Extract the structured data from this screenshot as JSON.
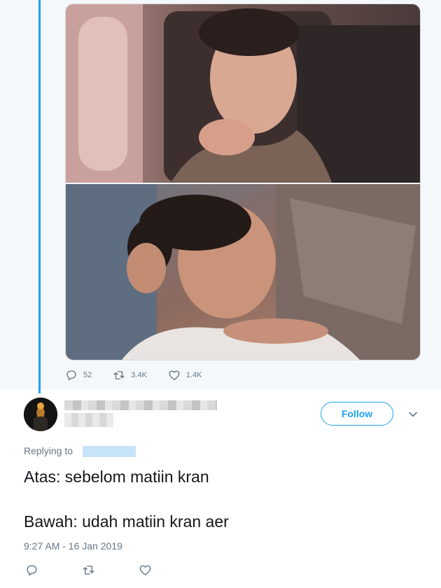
{
  "previous_tweet": {
    "reply_count": "52",
    "retweet_count": "3.4K",
    "like_count": "1.4K",
    "photos": [
      "photo-top",
      "photo-bottom"
    ]
  },
  "reply_tweet": {
    "follow_label": "Follow",
    "replying_prefix": "Replying to",
    "text_line_1": "Atas: sebelom matiin kran",
    "text_line_2": "Bawah: udah matiin kran aer",
    "timestamp": "9:27 AM - 16 Jan 2019"
  },
  "icons": {
    "reply": "reply-icon",
    "retweet": "retweet-icon",
    "like": "like-icon",
    "more": "chevron-down-icon"
  },
  "colors": {
    "accent": "#1da1f2",
    "secondary_text": "#657786",
    "primary_text": "#14171a",
    "previous_tweet_background": "#f5f8fa"
  }
}
